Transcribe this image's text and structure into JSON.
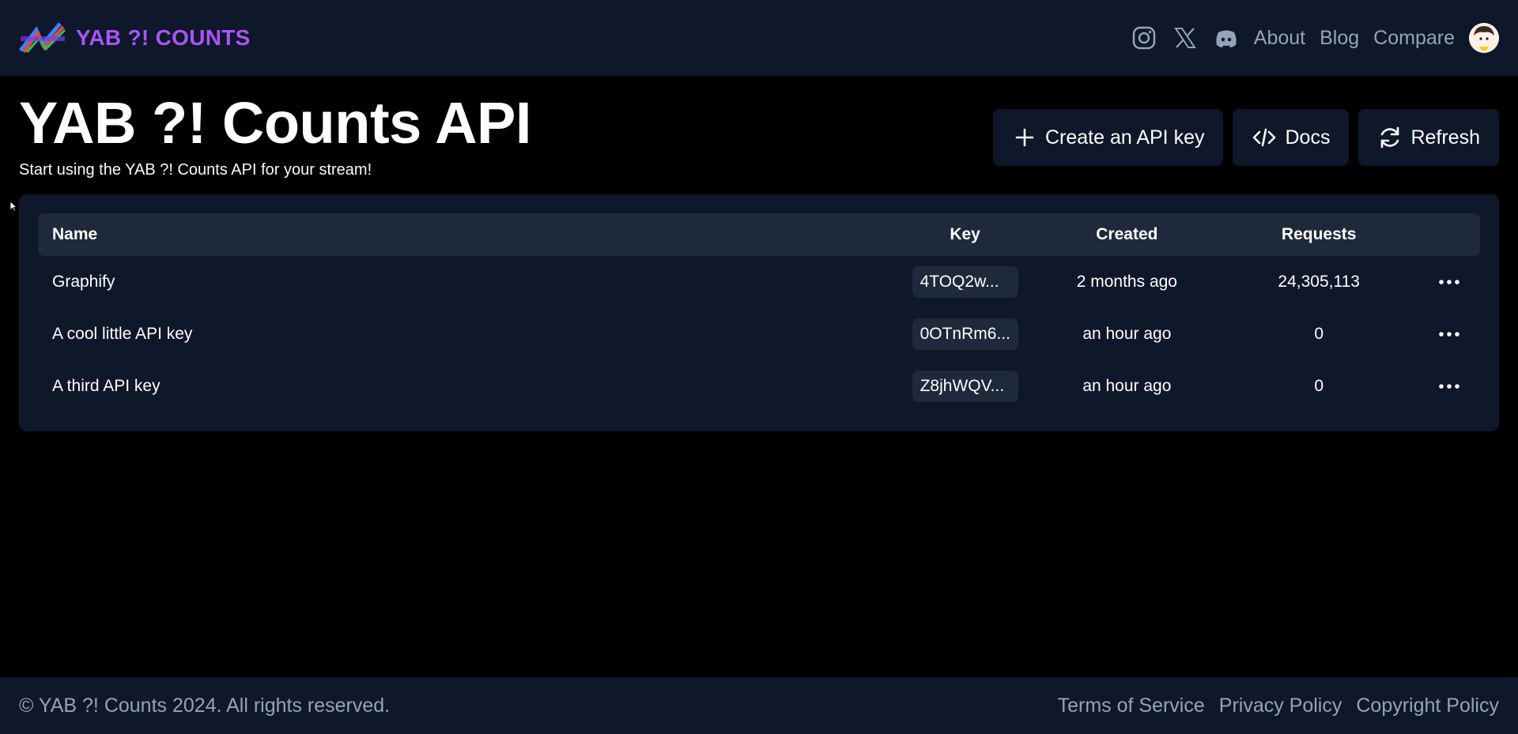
{
  "header": {
    "brand_name": "YAB ?! COUNTS",
    "nav": {
      "about": "About",
      "blog": "Blog",
      "compare": "Compare"
    },
    "icons": [
      "instagram-icon",
      "x-icon",
      "discord-icon"
    ]
  },
  "hero": {
    "title": "YAB ?! Counts API",
    "subtitle": "Start using the YAB ?! Counts API for your stream!"
  },
  "actions": {
    "create_label": "Create an API key",
    "docs_label": "Docs",
    "refresh_label": "Refresh"
  },
  "table": {
    "headers": {
      "name": "Name",
      "key": "Key",
      "created": "Created",
      "requests": "Requests"
    },
    "rows": [
      {
        "name": "Graphify",
        "key": "4TOQ2w...",
        "created": "2 months ago",
        "requests": "24,305,113"
      },
      {
        "name": "A cool little API key",
        "key": "0OTnRm6...",
        "created": "an hour ago",
        "requests": "0"
      },
      {
        "name": "A third API key",
        "key": "Z8jhWQV...",
        "created": "an hour ago",
        "requests": "0"
      }
    ]
  },
  "footer": {
    "copyright": "© YAB ?! Counts 2024. All rights reserved.",
    "links": {
      "terms": "Terms of Service",
      "privacy": "Privacy Policy",
      "copyright_policy": "Copyright Policy"
    }
  },
  "colors": {
    "brand": "#a855f7",
    "surface": "#0f172a",
    "surface_alt": "#1e293b",
    "muted_text": "#94a3b8",
    "background": "#000000"
  }
}
